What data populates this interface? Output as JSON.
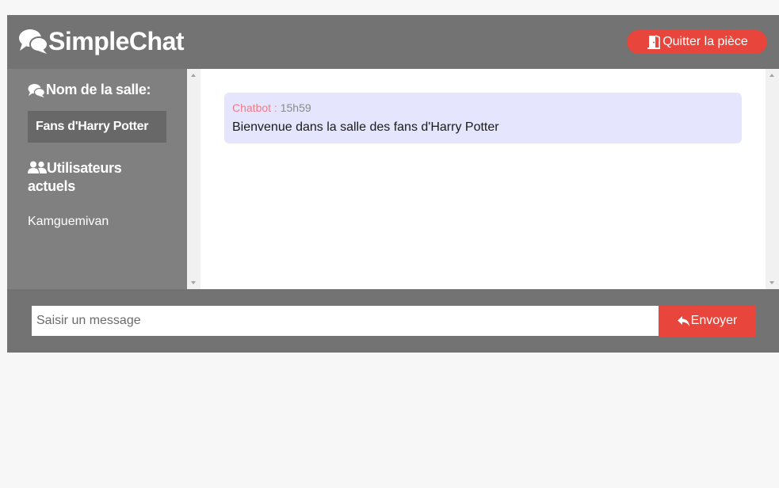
{
  "header": {
    "app_name": "SimpleChat",
    "app_icon": "comments-icon",
    "leave_label": "Quitter la pièce",
    "leave_icon": "door-exit-icon"
  },
  "sidebar": {
    "room_title": "Nom de la salle:",
    "room_icon": "comments-icon",
    "room_name": "Fans d'Harry Potter",
    "users_title": "Utilisateurs actuels",
    "users_icon": "users-icon",
    "users": [
      "Kamguemivan"
    ]
  },
  "messages": [
    {
      "author": "Chatbot :",
      "time": "15h59",
      "text": "Bienvenue dans la salle des fans d'Harry Potter"
    }
  ],
  "composer": {
    "placeholder": "Saisir un message",
    "value": "",
    "send_label": "Envoyer",
    "send_icon": "reply-icon"
  },
  "colors": {
    "header_bg": "#737373",
    "sidebar_bg": "#808080",
    "accent": "#e8453c",
    "message_bg": "#e5e6fd",
    "author_color": "#f07b88"
  }
}
